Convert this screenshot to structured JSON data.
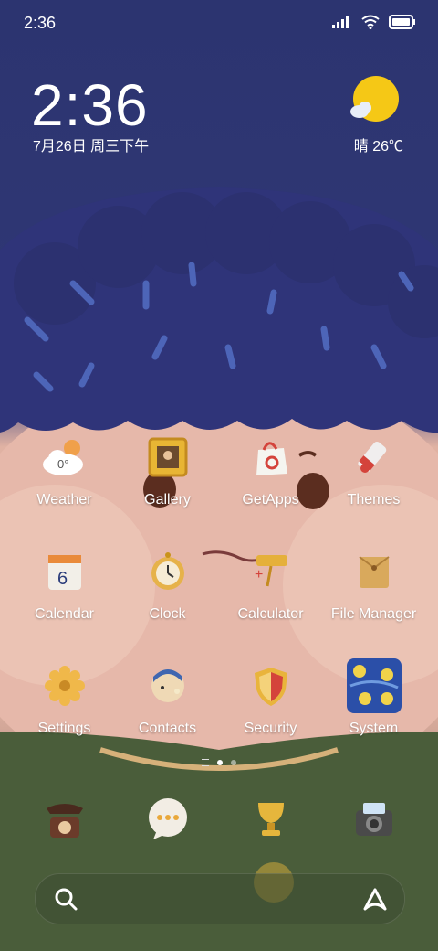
{
  "status": {
    "time": "2:36"
  },
  "clock_widget": {
    "time": "2:36",
    "date": "7月26日 周三下午"
  },
  "weather_widget": {
    "text": "晴 26℃"
  },
  "apps": [
    {
      "label": "Weather",
      "icon": "weather-cloud-icon"
    },
    {
      "label": "Gallery",
      "icon": "gallery-frame-icon"
    },
    {
      "label": "GetApps",
      "icon": "shopping-bag-icon"
    },
    {
      "label": "Themes",
      "icon": "paint-tube-icon"
    },
    {
      "label": "Calendar",
      "icon": "calendar-icon",
      "day": "6"
    },
    {
      "label": "Clock",
      "icon": "pocket-watch-icon"
    },
    {
      "label": "Calculator",
      "icon": "calculator-sign-icon"
    },
    {
      "label": "File Manager",
      "icon": "envelope-folder-icon"
    },
    {
      "label": "Settings",
      "icon": "gear-icon"
    },
    {
      "label": "Contacts",
      "icon": "portrait-icon"
    },
    {
      "label": "Security",
      "icon": "shield-icon"
    },
    {
      "label": "System",
      "icon": "starry-folder-icon"
    }
  ],
  "weather_icon_text": "0°",
  "dock": [
    {
      "icon": "telephone-icon"
    },
    {
      "icon": "message-bubble-icon"
    },
    {
      "icon": "trophy-browser-icon"
    },
    {
      "icon": "camera-icon"
    }
  ],
  "colors": {
    "sky": "#2c3470",
    "sun": "#f5c816",
    "skin": "#e8bcae",
    "sweater": "#4a5d3a"
  }
}
